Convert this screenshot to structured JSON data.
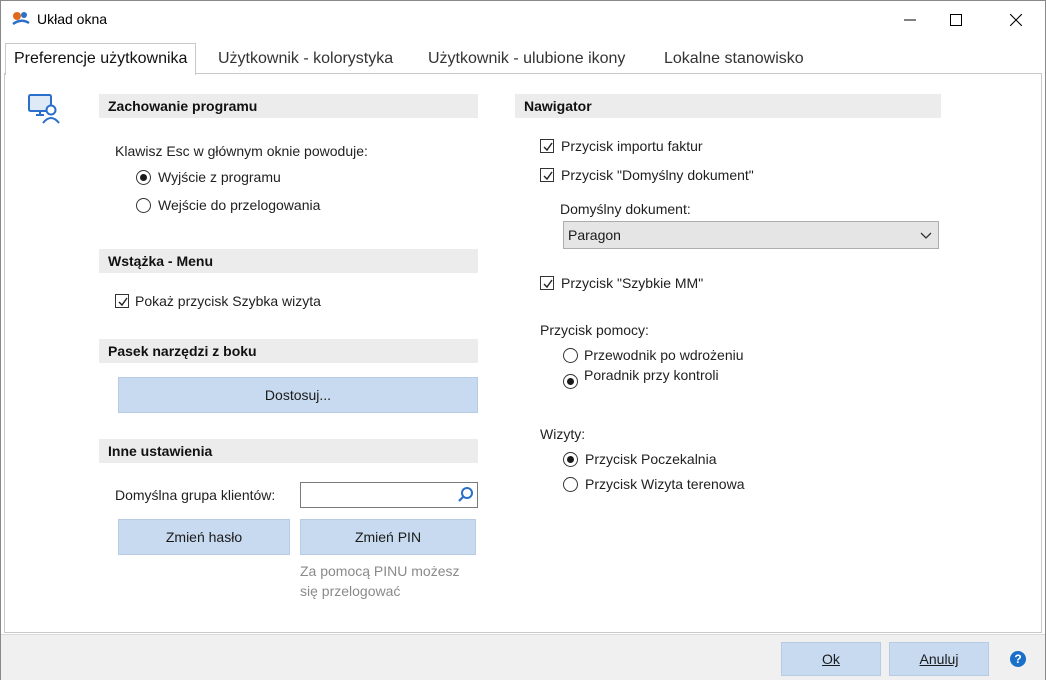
{
  "window": {
    "title": "Układ okna"
  },
  "tabs": [
    {
      "label": "Preferencje użytkownika"
    },
    {
      "label": "Użytkownik - kolorystyka"
    },
    {
      "label": "Użytkownik - ulubione ikony"
    },
    {
      "label": "Lokalne stanowisko"
    }
  ],
  "left": {
    "program_behavior": {
      "header": "Zachowanie programu",
      "question": "Klawisz Esc w głównym oknie powoduje:",
      "options": [
        {
          "label": "Wyjście z programu",
          "selected": true
        },
        {
          "label": "Wejście do przelogowania",
          "selected": false
        }
      ]
    },
    "ribbon": {
      "header": "Wstążka - Menu",
      "show_quick_visit": {
        "label": "Pokaż przycisk Szybka wizyta",
        "checked": true
      }
    },
    "side_toolbar": {
      "header": "Pasek narzędzi z boku",
      "customize_button": "Dostosuj..."
    },
    "other": {
      "header": "Inne ustawienia",
      "client_group_label": "Domyślna grupa klientów:",
      "client_group_value": "",
      "change_password_button": "Zmień hasło",
      "change_pin_button": "Zmień PIN",
      "pin_hint_line1": "Za pomocą PINU możesz",
      "pin_hint_line2": "się przelogować"
    }
  },
  "right": {
    "navigator": {
      "header": "Nawigator",
      "invoice_import": {
        "label": "Przycisk importu faktur",
        "checked": true
      },
      "default_document": {
        "label": "Przycisk \"Domyślny dokument\"",
        "checked": true
      },
      "default_document_label": "Domyślny dokument:",
      "default_document_value": "Paragon",
      "quick_mm": {
        "label": "Przycisk \"Szybkie MM\"",
        "checked": true
      },
      "help_button_label": "Przycisk pomocy:",
      "help_options": [
        {
          "label": "Przewodnik po wdrożeniu",
          "selected": false
        },
        {
          "label": "Poradnik przy kontroli",
          "selected": true
        }
      ],
      "visits_label": "Wizyty:",
      "visit_options": [
        {
          "label": "Przycisk Poczekalnia",
          "selected": true
        },
        {
          "label": "Przycisk Wizyta terenowa",
          "selected": false
        }
      ]
    }
  },
  "footer": {
    "ok_button": "Ok",
    "cancel_button": "Anuluj"
  },
  "colors": {
    "button_bg": "#c8daf0",
    "section_bg": "#ececec",
    "help_icon": "#1a6fc9"
  },
  "icons": {
    "app": "app-logo-icon",
    "section": "user-workstation-icon",
    "search": "search-icon",
    "help": "help-icon"
  }
}
